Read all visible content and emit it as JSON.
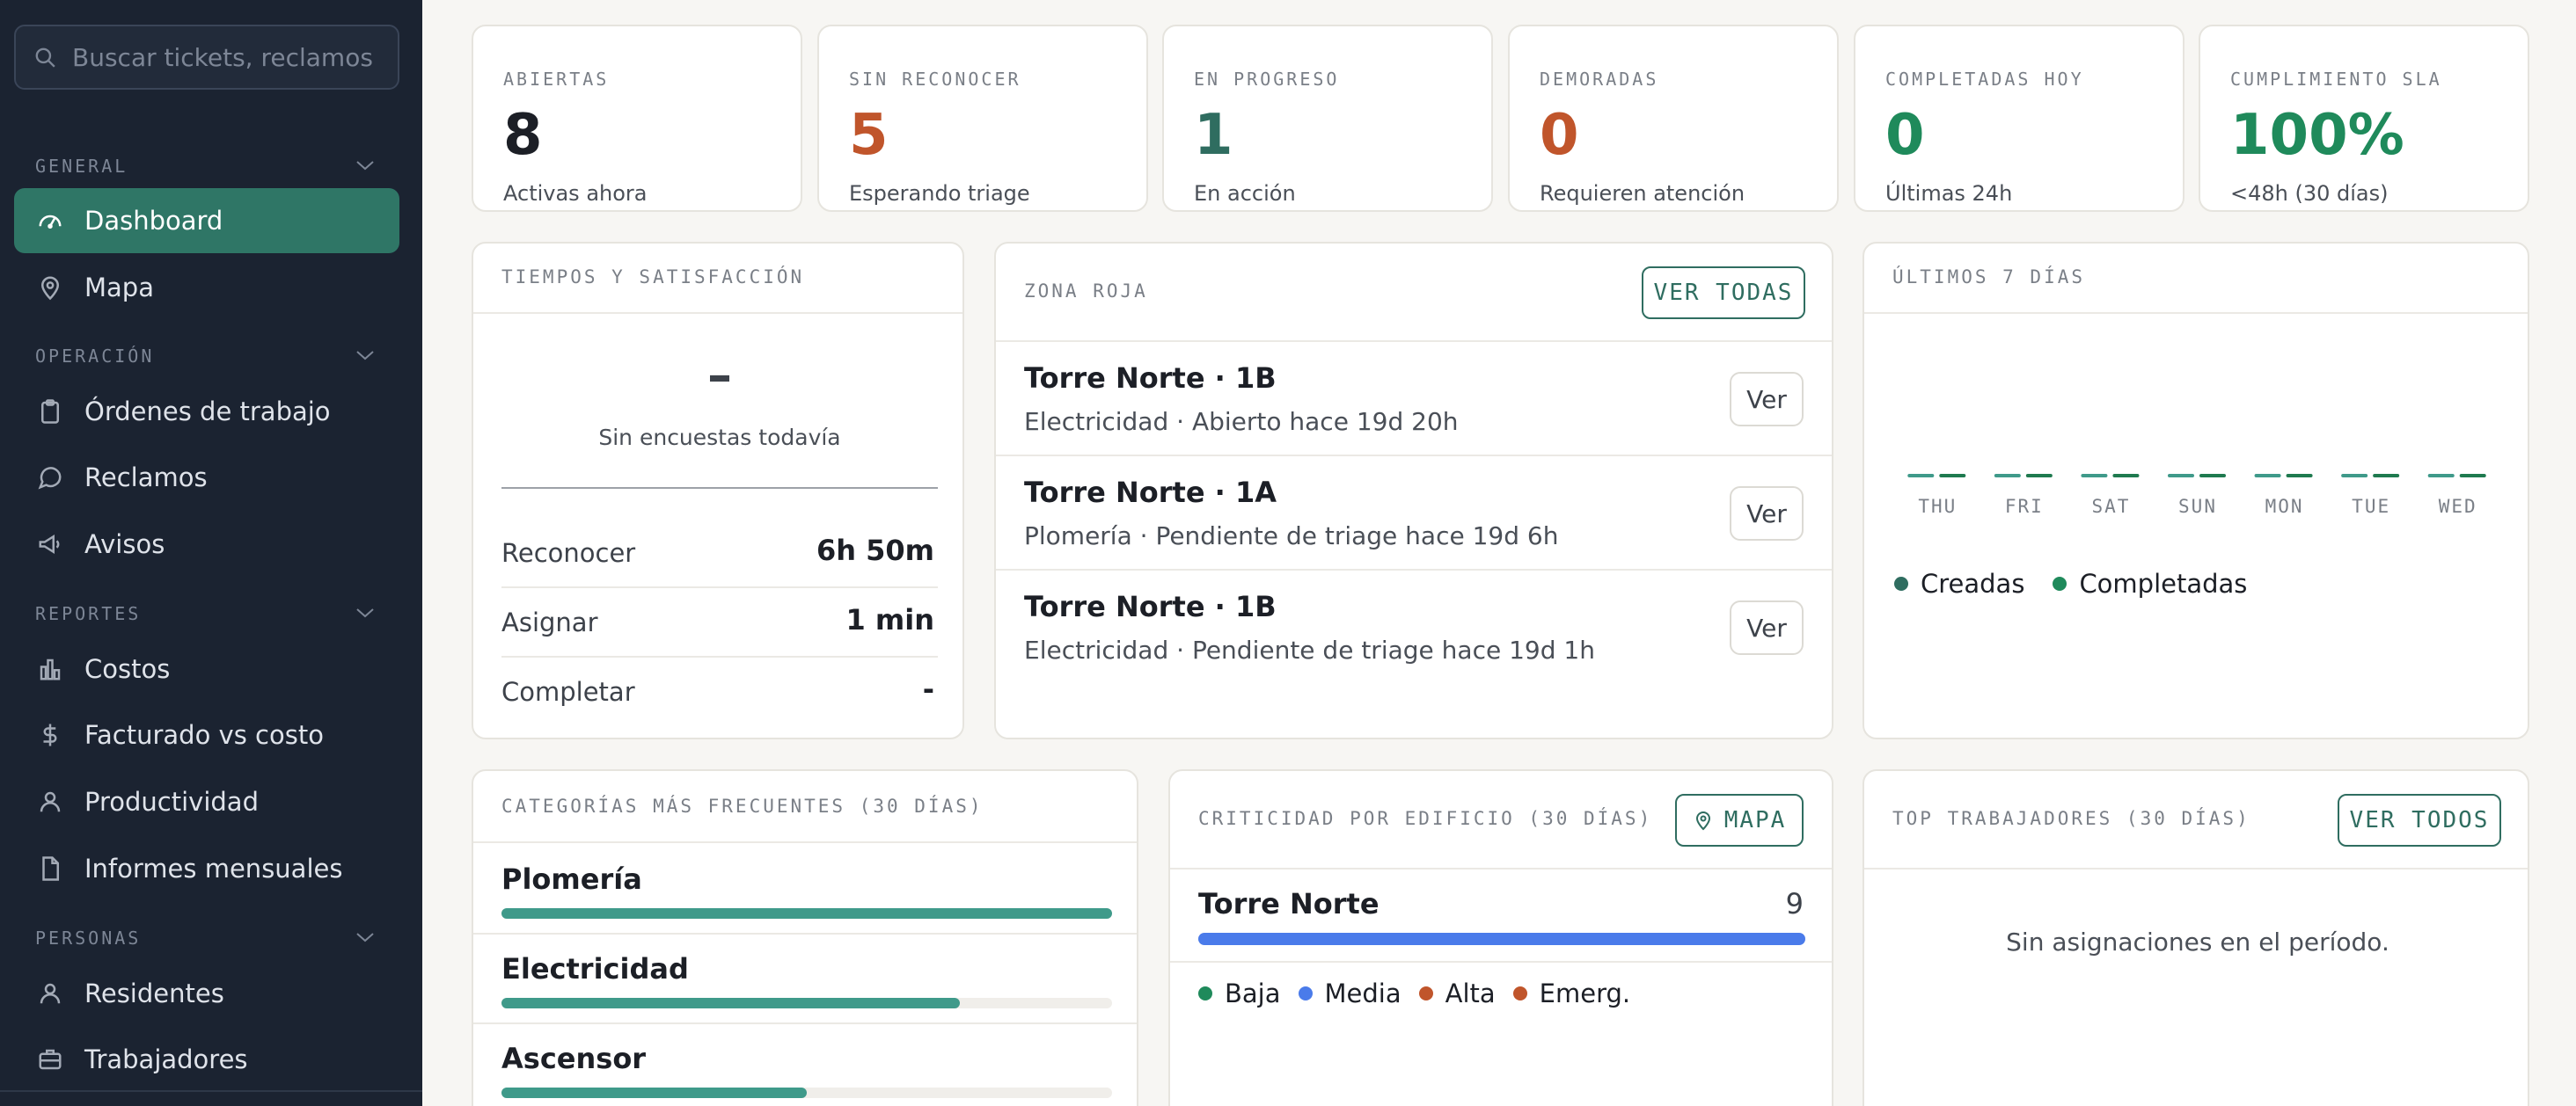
{
  "search": {
    "placeholder": "Buscar tickets, reclamos"
  },
  "sidebar": {
    "sections": [
      {
        "label": "GENERAL",
        "items": [
          {
            "label": "Dashboard",
            "icon": "gauge-icon",
            "active": true
          },
          {
            "label": "Mapa",
            "icon": "map-pin-icon"
          }
        ]
      },
      {
        "label": "OPERACIÓN",
        "items": [
          {
            "label": "Órdenes de trabajo",
            "icon": "clipboard-icon"
          },
          {
            "label": "Reclamos",
            "icon": "chat-bubble-icon"
          },
          {
            "label": "Avisos",
            "icon": "megaphone-icon"
          }
        ]
      },
      {
        "label": "REPORTES",
        "items": [
          {
            "label": "Costos",
            "icon": "bar-chart-icon"
          },
          {
            "label": "Facturado vs costo",
            "icon": "dollar-icon"
          },
          {
            "label": "Productividad",
            "icon": "user-icon"
          },
          {
            "label": "Informes mensuales",
            "icon": "document-icon"
          }
        ]
      },
      {
        "label": "PERSONAS",
        "items": [
          {
            "label": "Residentes",
            "icon": "users-icon"
          },
          {
            "label": "Trabajadores",
            "icon": "briefcase-icon"
          }
        ]
      }
    ]
  },
  "stats": [
    {
      "label": "ABIERTAS",
      "value": "8",
      "sub": "Activas ahora",
      "color": "#1c1f26"
    },
    {
      "label": "SIN RECONOCER",
      "value": "5",
      "sub": "Esperando triage",
      "color": "#c0552b"
    },
    {
      "label": "EN PROGRESO",
      "value": "1",
      "sub": "En acción",
      "color": "#2f6d60"
    },
    {
      "label": "DEMORADAS",
      "value": "0",
      "sub": "Requieren atención",
      "color": "#c0552b"
    },
    {
      "label": "COMPLETADAS HOY",
      "value": "0",
      "sub": "Últimas 24h",
      "color": "#1f8a5b"
    },
    {
      "label": "CUMPLIMIENTO SLA",
      "value": "100%",
      "sub": "<48h (30 días)",
      "color": "#1f8a5b"
    }
  ],
  "times": {
    "title": "TIEMPOS Y SATISFACCIÓN",
    "score": "–",
    "score_sub": "Sin encuestas todavía",
    "rows": [
      {
        "label": "Reconocer",
        "value": "6h 50m"
      },
      {
        "label": "Asignar",
        "value": "1 min"
      },
      {
        "label": "Completar",
        "value": "-"
      }
    ]
  },
  "red_zone": {
    "title": "ZONA ROJA",
    "button": "VER TODAS",
    "items": [
      {
        "title": "Torre Norte · 1B",
        "sub": "Electricidad · Abierto hace 19d 20h",
        "button": "Ver"
      },
      {
        "title": "Torre Norte · 1A",
        "sub": "Plomería · Pendiente de triage hace 19d 6h",
        "button": "Ver"
      },
      {
        "title": "Torre Norte · 1B",
        "sub": "Electricidad · Pendiente de triage hace 19d 1h",
        "button": "Ver"
      }
    ]
  },
  "last7": {
    "title": "ÚLTIMOS 7 DÍAS"
  },
  "chart_data": {
    "type": "bar",
    "title": "ÚLTIMOS 7 DÍAS",
    "categories": [
      "THU",
      "FRI",
      "SAT",
      "SUN",
      "MON",
      "TUE",
      "WED"
    ],
    "series": [
      {
        "name": "Creadas",
        "values": [
          0,
          0,
          0,
          0,
          0,
          0,
          0
        ],
        "color": "#3f9a8a"
      },
      {
        "name": "Completadas",
        "values": [
          0,
          0,
          0,
          0,
          0,
          0,
          0
        ],
        "color": "#1f7a4f"
      }
    ],
    "legend": "bottom-left"
  },
  "categories": {
    "title": "CATEGORÍAS MÁS FRECUENTES (30 DÍAS)",
    "max": 4,
    "items": [
      {
        "name": "Plomería",
        "count": 4
      },
      {
        "name": "Electricidad",
        "count": 3
      },
      {
        "name": "Ascensor",
        "count": 2
      }
    ]
  },
  "criticality": {
    "title": "CRITICIDAD POR EDIFICIO (30 DÍAS)",
    "button": "MAPA",
    "buildings": [
      {
        "name": "Torre Norte",
        "count": 9,
        "fill_fraction": 1.0
      }
    ],
    "legend": [
      {
        "label": "Baja",
        "color": "#1f8a5b"
      },
      {
        "label": "Media",
        "color": "#4a7bea"
      },
      {
        "label": "Alta",
        "color": "#c0552b"
      },
      {
        "label": "Emerg.",
        "color": "#c0552b"
      }
    ]
  },
  "top_workers": {
    "title": "TOP TRABAJADORES (30 DÍAS)",
    "button": "VER TODOS",
    "empty": "Sin asignaciones en el período."
  }
}
